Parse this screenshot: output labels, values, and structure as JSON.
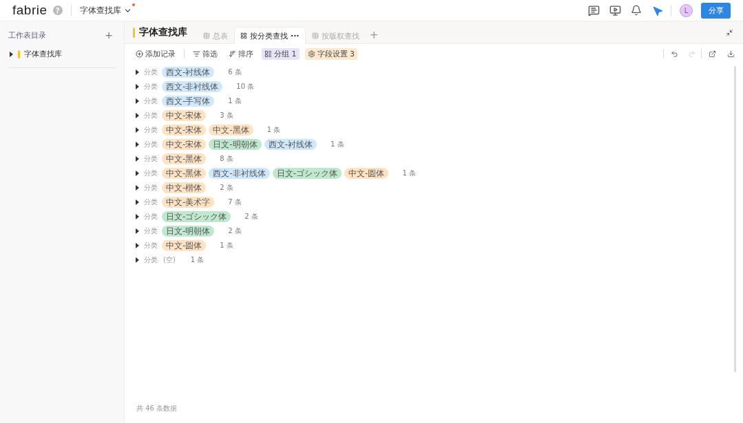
{
  "topbar": {
    "logo": "fabrie",
    "help": "?",
    "doc_title": "字体查找库",
    "unsaved": true,
    "avatar": "L",
    "share": "分享"
  },
  "sidebar": {
    "title": "工作表目录",
    "add": "+",
    "items": [
      {
        "label": "字体查找库",
        "expanded": false
      }
    ]
  },
  "sheet": {
    "title": "字体查找库",
    "tabs": [
      {
        "label": "总表",
        "kind": "grid",
        "selected": false
      },
      {
        "label": "按分类查找",
        "kind": "gallery",
        "selected": true,
        "more": "···"
      },
      {
        "label": "按版权查找",
        "kind": "grid",
        "selected": false
      }
    ],
    "add_tab": "+"
  },
  "toolbar": [
    {
      "label": "添加记录",
      "kind": "add",
      "active": false
    },
    {
      "label": "筛选",
      "kind": "filter",
      "active": false
    },
    {
      "label": "排序",
      "kind": "sort",
      "active": false
    },
    {
      "label": "分组 1",
      "kind": "group",
      "active": true
    },
    {
      "label": "字段设置 3",
      "kind": "fields",
      "active": true
    }
  ],
  "groups": [
    {
      "field": "分类",
      "expanded": false,
      "count": "6 条",
      "tags": [
        {
          "label": "西文-衬线体",
          "color": "#cfe8fb"
        }
      ]
    },
    {
      "field": "分类",
      "expanded": false,
      "count": "10 条",
      "tags": [
        {
          "label": "西文-非衬线体",
          "color": "#cfe8fb"
        }
      ]
    },
    {
      "field": "分类",
      "expanded": false,
      "count": "1 条",
      "tags": [
        {
          "label": "西文-手写体",
          "color": "#cfe8fb"
        }
      ]
    },
    {
      "field": "分类",
      "expanded": false,
      "count": "3 条",
      "tags": [
        {
          "label": "中文-宋体",
          "color": "#fde3c3"
        }
      ]
    },
    {
      "field": "分类",
      "expanded": false,
      "count": "1 条",
      "tags": [
        {
          "label": "中文-宋体",
          "color": "#fde3c3"
        },
        {
          "label": "中文-黑体",
          "color": "#fde3c3"
        }
      ]
    },
    {
      "field": "分类",
      "expanded": false,
      "count": "1 条",
      "tags": [
        {
          "label": "中文-宋体",
          "color": "#fde3c3"
        },
        {
          "label": "日文-明朝体",
          "color": "#bfe8cf"
        },
        {
          "label": "西文-衬线体",
          "color": "#cfe8fb"
        }
      ]
    },
    {
      "field": "分类",
      "expanded": false,
      "count": "8 条",
      "tags": [
        {
          "label": "中文-黑体",
          "color": "#fde3c3"
        }
      ]
    },
    {
      "field": "分类",
      "expanded": false,
      "count": "1 条",
      "tags": [
        {
          "label": "中文-黑体",
          "color": "#fde3c3"
        },
        {
          "label": "西文-非衬线体",
          "color": "#cfe8fb"
        },
        {
          "label": "日文-ゴシック体",
          "color": "#bfe8cf"
        },
        {
          "label": "中文-圆体",
          "color": "#fde3c3"
        }
      ]
    },
    {
      "field": "分类",
      "expanded": false,
      "count": "2 条",
      "tags": [
        {
          "label": "中文-楷体",
          "color": "#fde3c3"
        }
      ]
    },
    {
      "field": "分类",
      "expanded": false,
      "count": "7 条",
      "tags": [
        {
          "label": "中文-美术字",
          "color": "#fde3c3"
        }
      ]
    },
    {
      "field": "分类",
      "expanded": false,
      "count": "2 条",
      "tags": [
        {
          "label": "日文-ゴシック体",
          "color": "#bfe8cf"
        }
      ]
    },
    {
      "field": "分类",
      "expanded": false,
      "count": "2 条",
      "tags": [
        {
          "label": "日文-明朝体",
          "color": "#bfe8cf"
        }
      ]
    },
    {
      "field": "分类",
      "expanded": false,
      "count": "1 条",
      "tags": [
        {
          "label": "中文-圆体",
          "color": "#fde3c3"
        }
      ]
    },
    {
      "field": "分类",
      "expanded": false,
      "count": "1 条",
      "empty": "(空)"
    }
  ],
  "footer": "共 46 条数据"
}
